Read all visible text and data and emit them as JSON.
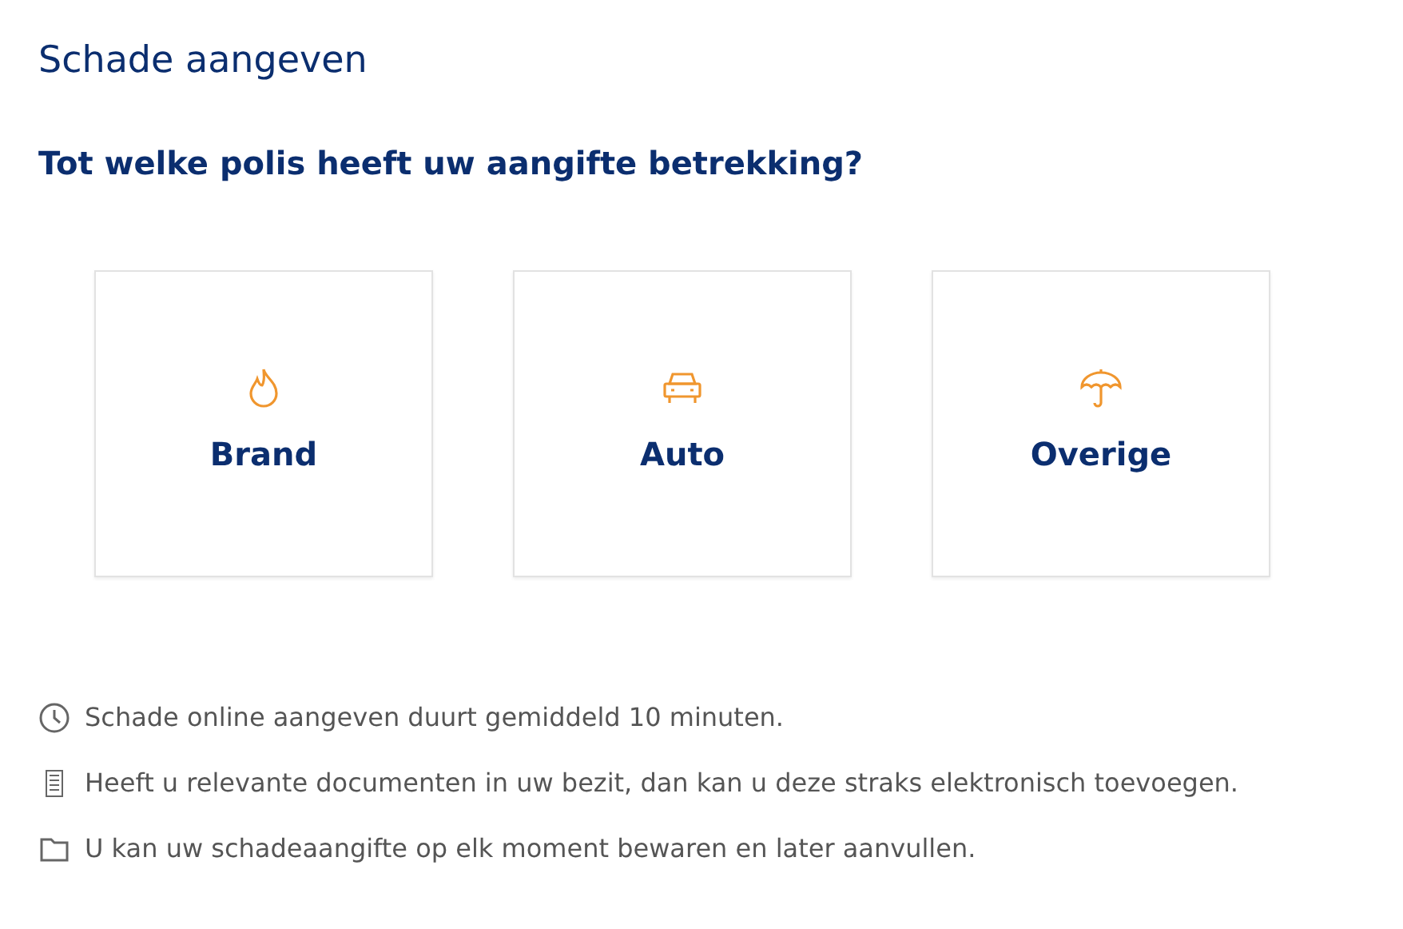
{
  "title": "Schade aangeven",
  "question": "Tot welke polis heeft uw aangifte betrekking?",
  "options": [
    {
      "label": "Brand",
      "kind": "flame"
    },
    {
      "label": "Auto",
      "kind": "car"
    },
    {
      "label": "Overige",
      "kind": "umbrella"
    }
  ],
  "notes": [
    {
      "text": "Schade online aangeven duurt gemiddeld 10 minuten.",
      "kind": "clock"
    },
    {
      "text": "Heeft u relevante documenten in uw bezit, dan kan u deze straks elektronisch toevoegen.",
      "kind": "document"
    },
    {
      "text": "U kan uw schadeaangifte op elk moment bewaren en later aanvullen.",
      "kind": "folder"
    }
  ]
}
